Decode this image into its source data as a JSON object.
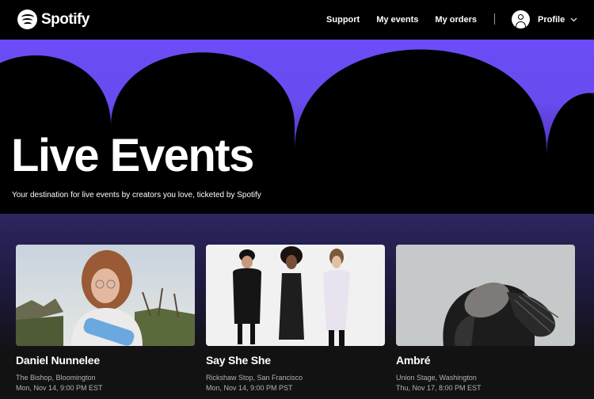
{
  "nav": {
    "brand": "Spotify",
    "links": [
      "Support",
      "My events",
      "My orders"
    ],
    "profile_label": "Profile"
  },
  "hero": {
    "title": "Live Events",
    "subtitle": "Your destination for live events by creators you love, ticketed by Spotify"
  },
  "events": [
    {
      "name": "Daniel Nunnelee",
      "venue": "The Bishop, Bloomington",
      "date": "Mon, Nov 14, 9:00 PM EST"
    },
    {
      "name": "Say She She",
      "venue": "Rickshaw Stop, San Francisco",
      "date": "Mon, Nov 14, 9:00 PM PST"
    },
    {
      "name": "Ambré",
      "venue": "Union Stage, Washington",
      "date": "Thu, Nov 17, 8:00 PM EST"
    }
  ],
  "colors": {
    "accent": "#6b4cf6",
    "background": "#121212",
    "nav": "#000000",
    "muted_text": "#b3b3b3"
  }
}
